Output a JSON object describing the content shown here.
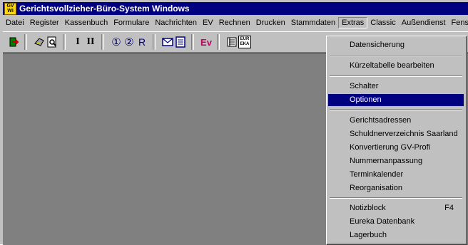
{
  "window": {
    "title": "Gerichtsvollzieher-Büro-System Windows",
    "icon_text_top": "GV",
    "icon_text_bottom": "WI"
  },
  "menubar": [
    "Datei",
    "Register",
    "Kassenbuch",
    "Formulare",
    "Nachrichten",
    "EV",
    "Rechnen",
    "Drucken",
    "Stammdaten",
    "Extras",
    "Classic",
    "Außendienst",
    "Fenster",
    "?"
  ],
  "toolbar": {
    "roman_one": "I",
    "roman_two": "II",
    "circled_one": "①",
    "circled_two": "②",
    "letter_r": "R",
    "ev_label": "Ev",
    "eur_label_top": "EUR",
    "eur_label_bottom": "EKA"
  },
  "extras_menu": {
    "datensicherung": "Datensicherung",
    "kuerzeltabelle": "Kürzeltabelle bearbeiten",
    "schalter": "Schalter",
    "optionen": "Optionen",
    "gerichtsadressen": "Gerichtsadressen",
    "schuldnerverzeichnis": "Schuldnerverzeichnis Saarland",
    "konvertierung": "Konvertierung GV-Profi",
    "nummernanpassung": "Nummernanpassung",
    "terminkalender": "Terminkalender",
    "reorganisation": "Reorganisation",
    "notizblock": "Notizblock",
    "notizblock_shortcut": "F4",
    "eureka": "Eureka Datenbank",
    "lagerbuch": "Lagerbuch"
  },
  "colors": {
    "titlebar": "#000080",
    "selection": "#000080",
    "workspace": "#808080",
    "chrome": "#c0c0c0"
  }
}
